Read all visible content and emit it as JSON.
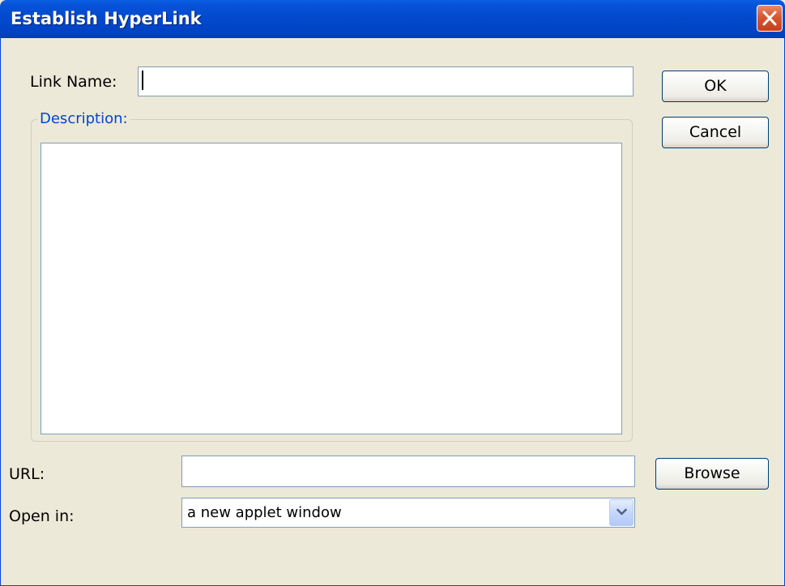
{
  "window": {
    "title": "Establish HyperLink"
  },
  "link_name": {
    "label": "Link Name:",
    "value": ""
  },
  "description": {
    "legend": "Description:",
    "value": ""
  },
  "url": {
    "label": "URL:",
    "value": ""
  },
  "open_in": {
    "label": "Open in:",
    "selected": "a new applet window"
  },
  "buttons": {
    "ok": "OK",
    "cancel": "Cancel",
    "browse": "Browse"
  },
  "icons": {
    "close": "close-icon",
    "dropdown": "chevron-down-icon"
  },
  "colors": {
    "titlebar": "#0149cc",
    "close_button": "#d9562f",
    "dialog_bg": "#ece9d8",
    "legend_text": "#0046d5"
  }
}
